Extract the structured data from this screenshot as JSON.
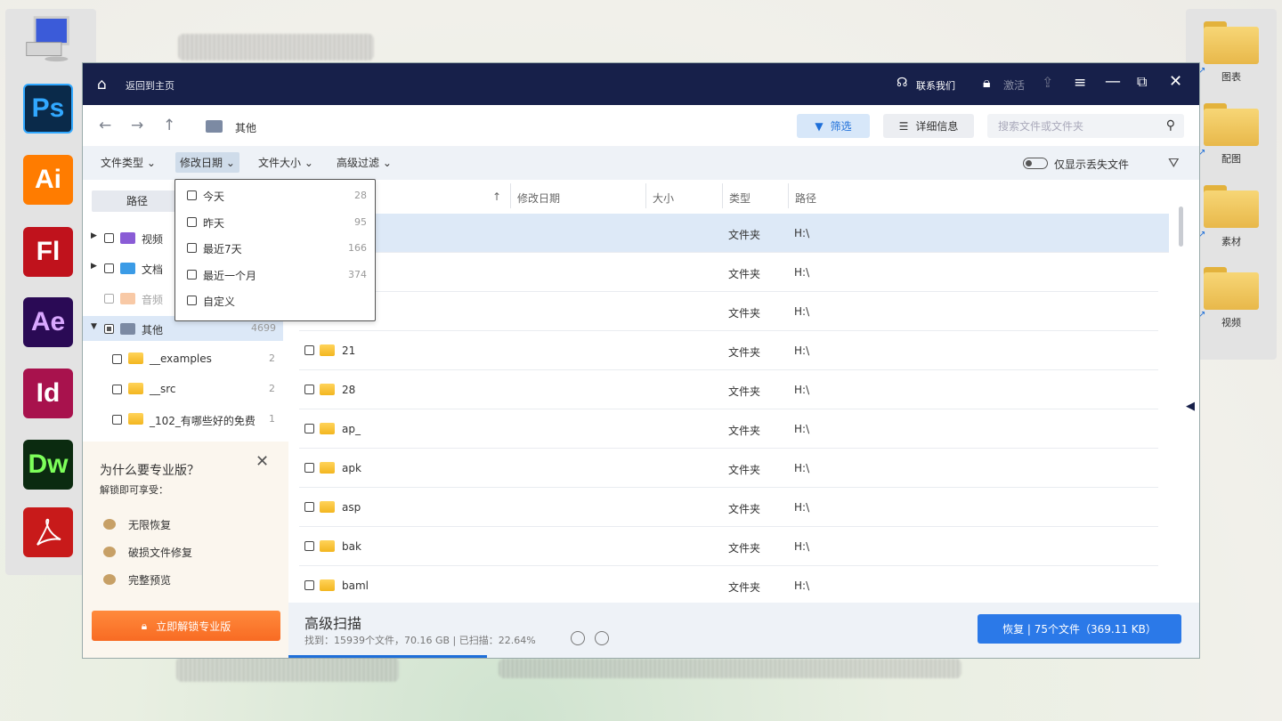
{
  "desktop": {
    "left_dock": [
      {
        "icon": "my-computer-icon"
      },
      {
        "icon": "photoshop-icon",
        "text": "Ps",
        "color": "#31a8ff",
        "bg": "#001e36"
      },
      {
        "icon": "illustrator-icon",
        "text": "Ai",
        "color": "#ffffff",
        "bg": "#ff7c00"
      },
      {
        "icon": "flash-icon",
        "text": "Fl",
        "color": "#ffffff",
        "bg": "#c0121c"
      },
      {
        "icon": "after-effects-icon",
        "text": "Ae",
        "color": "#d9a7ff",
        "bg": "#2a0a55"
      },
      {
        "icon": "indesign-icon",
        "text": "Id",
        "color": "#ffffff",
        "bg": "#a8124d"
      },
      {
        "icon": "dreamweaver-icon",
        "text": "Dw",
        "color": "#7dff5a",
        "bg": "#0b2b10"
      },
      {
        "icon": "acrobat-icon",
        "color": "#ffffff",
        "bg": "#c81a1a"
      }
    ],
    "right_dock": [
      {
        "label": "图表"
      },
      {
        "label": "配图"
      },
      {
        "label": "素材"
      },
      {
        "label": "视频"
      }
    ]
  },
  "titlebar": {
    "back_home": "返回到主页",
    "contact": "联系我们",
    "activate": "激活"
  },
  "navbar": {
    "crumb": "其他",
    "filter_btn": "筛选",
    "detail_btn": "详细信息",
    "search_placeholder": "搜索文件或文件夹"
  },
  "filterbar": {
    "items": [
      "文件类型 ⌄",
      "修改日期 ⌄",
      "文件大小 ⌄",
      "高级过滤 ⌄"
    ],
    "toggle_label": "仅显示丢失文件"
  },
  "date_dropdown": [
    {
      "label": "今天",
      "count": "28"
    },
    {
      "label": "昨天",
      "count": "95"
    },
    {
      "label": "最近7天",
      "count": "166"
    },
    {
      "label": "最近一个月",
      "count": "374"
    },
    {
      "label": "自定义",
      "count": ""
    }
  ],
  "sidebar": {
    "tab": "路径",
    "tree": [
      {
        "label": "视频",
        "count": ""
      },
      {
        "label": "文档",
        "count": ""
      },
      {
        "label": "音频",
        "count": ""
      },
      {
        "label": "其他",
        "count": "4699"
      },
      {
        "label": "__examples",
        "count": "2"
      },
      {
        "label": "__src",
        "count": "2"
      },
      {
        "label": "_102_有哪些好的免费",
        "count": "1"
      }
    ],
    "promo": {
      "title": "为什么要专业版？",
      "subtitle": "解锁即可享受：",
      "perks": [
        "无限恢复",
        "破损文件修复",
        "完整预览"
      ],
      "button": "立即解锁专业版"
    }
  },
  "table": {
    "headers": {
      "name_sort": "↑",
      "modified": "修改日期",
      "size": "大小",
      "type": "类型",
      "path": "路径"
    },
    "rows": [
      {
        "name": "",
        "type": "文件夹",
        "path": "H:\\"
      },
      {
        "name": "",
        "type": "文件夹",
        "path": "H:\\"
      },
      {
        "name": "",
        "type": "文件夹",
        "path": "H:\\"
      },
      {
        "name": "21",
        "type": "文件夹",
        "path": "H:\\"
      },
      {
        "name": "28",
        "type": "文件夹",
        "path": "H:\\"
      },
      {
        "name": "ap_",
        "type": "文件夹",
        "path": "H:\\"
      },
      {
        "name": "apk",
        "type": "文件夹",
        "path": "H:\\"
      },
      {
        "name": "asp",
        "type": "文件夹",
        "path": "H:\\"
      },
      {
        "name": "bak",
        "type": "文件夹",
        "path": "H:\\"
      },
      {
        "name": "baml",
        "type": "文件夹",
        "path": "H:\\"
      }
    ]
  },
  "footer": {
    "scan_title": "高级扫描",
    "scan_stats": "找到：15939个文件，70.16 GB | 已扫描：22.64%",
    "progress": 0.2264,
    "recover_btn": "恢复 | 75个文件（369.11 KB）"
  },
  "colors": {
    "titlebar": "#17204a",
    "accent": "#1e6fd9",
    "promo_button": "#f86b23"
  }
}
